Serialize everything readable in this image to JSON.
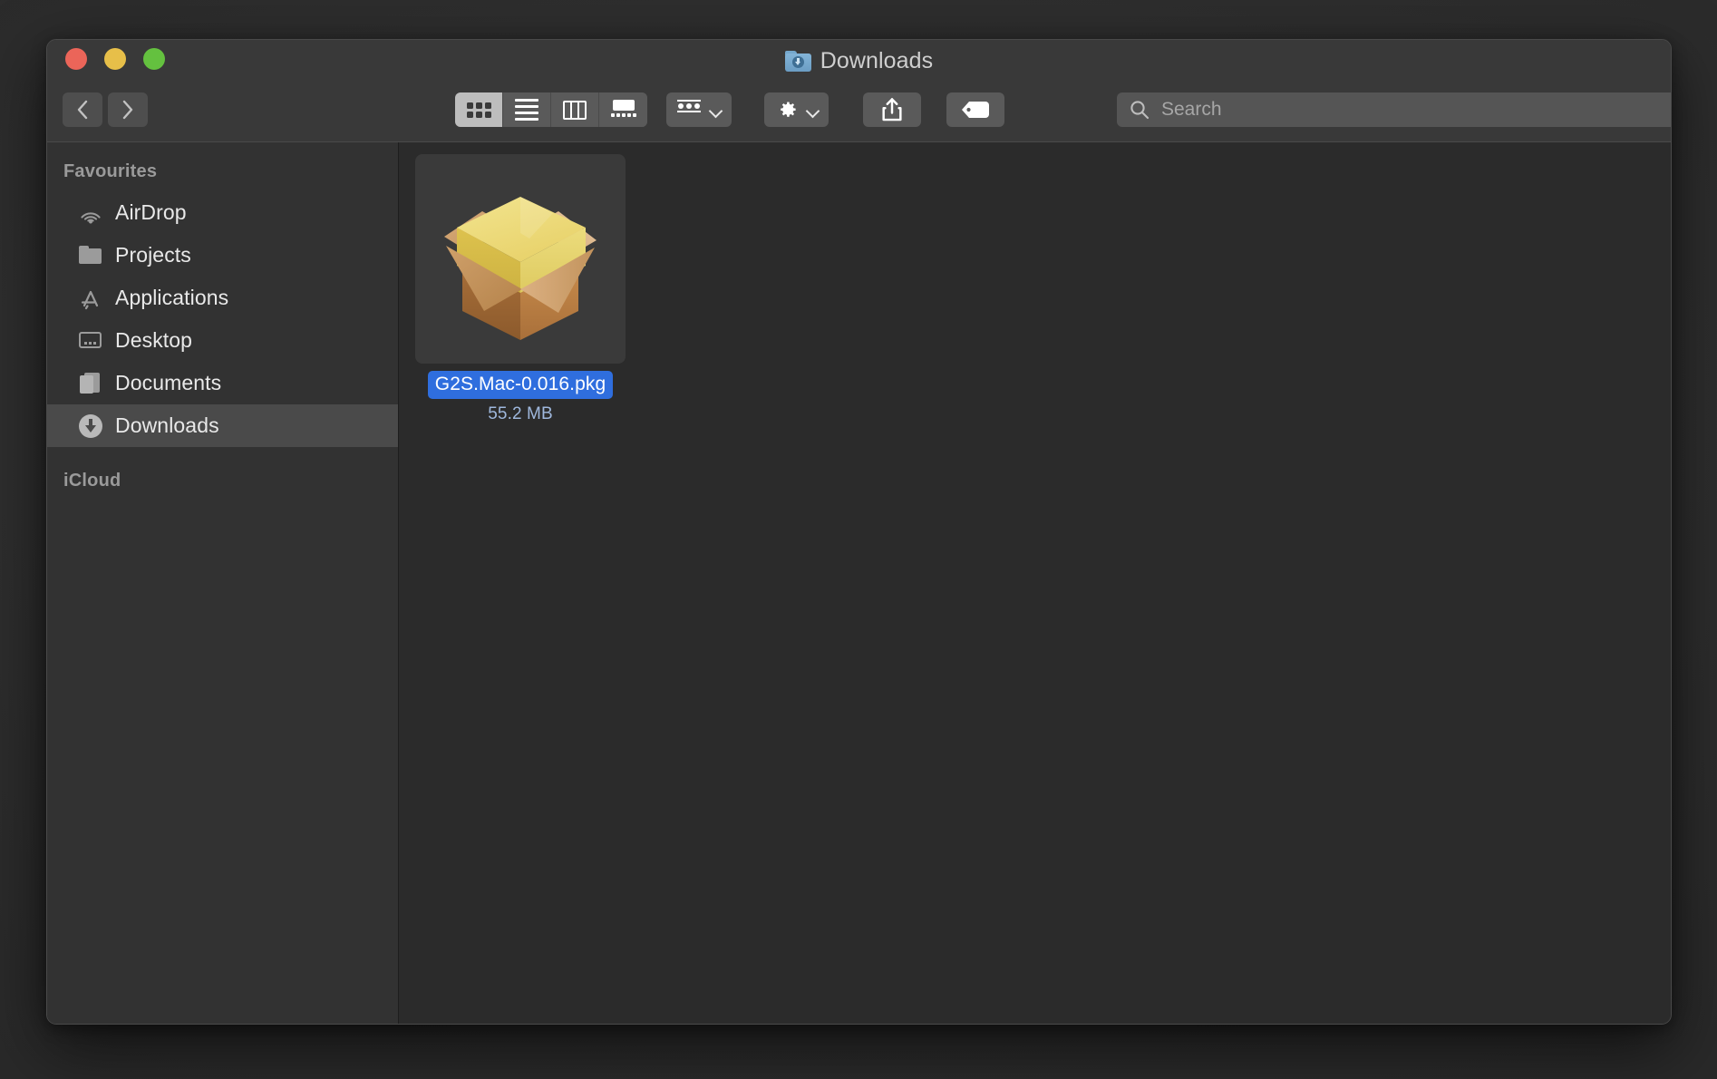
{
  "window": {
    "title": "Downloads",
    "title_icon": "downloads-folder-icon",
    "traffic_lights": [
      {
        "name": "close-button",
        "color": "#eb6559"
      },
      {
        "name": "minimise-button",
        "color": "#e7bf49"
      },
      {
        "name": "zoom-button",
        "color": "#64c13f"
      }
    ]
  },
  "toolbar": {
    "back_label": "Back",
    "forward_label": "Forward",
    "view_modes": [
      {
        "name": "icon-view",
        "label": "as Icons",
        "selected": true
      },
      {
        "name": "list-view",
        "label": "as List",
        "selected": false
      },
      {
        "name": "column-view",
        "label": "as Columns",
        "selected": false
      },
      {
        "name": "gallery-view",
        "label": "as Gallery",
        "selected": false
      }
    ],
    "group_label": "Group",
    "action_label": "Action",
    "share_label": "Share",
    "tag_label": "Tags"
  },
  "search": {
    "placeholder": "Search",
    "value": ""
  },
  "sidebar": {
    "sections": [
      {
        "header": "Favourites",
        "items": [
          {
            "label": "AirDrop",
            "icon": "airdrop-icon",
            "selected": false
          },
          {
            "label": "Projects",
            "icon": "folder-icon",
            "selected": false
          },
          {
            "label": "Applications",
            "icon": "applications-icon",
            "selected": false
          },
          {
            "label": "Desktop",
            "icon": "desktop-icon",
            "selected": false
          },
          {
            "label": "Documents",
            "icon": "documents-icon",
            "selected": false
          },
          {
            "label": "Downloads",
            "icon": "downloads-icon",
            "selected": true
          }
        ]
      },
      {
        "header": "iCloud",
        "items": []
      }
    ]
  },
  "content": {
    "files": [
      {
        "name": "G2S.Mac-0.016.pkg",
        "size": "55.2 MB",
        "icon": "pkg-installer-box-icon",
        "selected": true
      }
    ]
  },
  "colors": {
    "selection_blue": "#2f6ede",
    "window_chrome": "#393939",
    "content_bg": "#2b2b2b",
    "sidebar_bg": "#323232",
    "sidebar_selected": "#4a4a4a"
  }
}
